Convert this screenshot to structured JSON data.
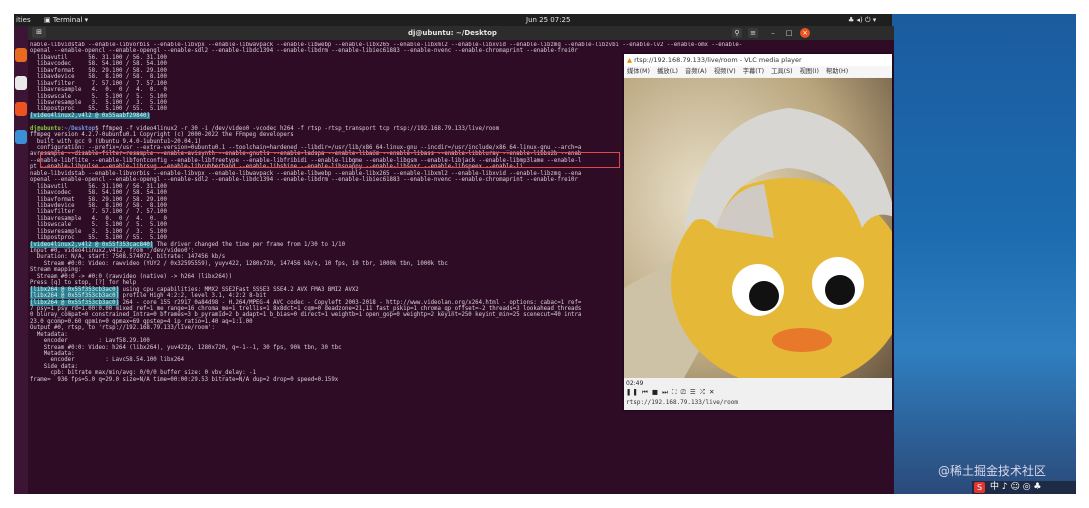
{
  "topbar": {
    "activities": "ities",
    "terminal_menu": "Terminal",
    "clock": "Jun 25 07:25"
  },
  "terminal": {
    "title": "dj@ubuntu: ~/Desktop",
    "lines": [
      {
        "t": "nable-libvidstab --enable-libvorbis --enable-libvpx --enable-libwavpack --enable-libwebp --enable-libx265 --enable-libxml2 --enable-libxvid --enable-libzmq --enable-libzvbi --enable-lv2 --enable-omx --enable-"
      },
      {
        "t": "openal --enable-opencl --enable-opengl --enable-sdl2 --enable-libdc1394 --enable-libdrm --enable-libiec61883 --enable-nvenc --enable-chromaprint --enable-frei0r"
      },
      {
        "t": "  libavutil      56. 31.100 / 56. 31.100"
      },
      {
        "t": "  libavcodec     58. 54.100 / 58. 54.100"
      },
      {
        "t": "  libavformat    58. 29.100 / 58. 29.100"
      },
      {
        "t": "  libavdevice    58.  8.100 / 58.  8.100"
      },
      {
        "t": "  libavfilter     7. 57.100 /  7. 57.100"
      },
      {
        "t": "  libavresample   4.  0.  0 /  4.  0.  0"
      },
      {
        "t": "  libswscale      5.  5.100 /  5.  5.100"
      },
      {
        "t": "  libswresample   3.  5.100 /  3.  5.100"
      },
      {
        "t": "  libpostproc    55.  5.100 / 55.  5.100"
      },
      {
        "t": "[video4linux2,v4l2 @ 0x55aabf29840]",
        "cls": "hl-cyan"
      },
      {
        "t": ""
      },
      {
        "t": "",
        "prompt": true,
        "user": "dj@ubuntu",
        "path": "~/Desktop",
        "cmd": "$ ffmpeg -f video4linux2 -r 30 -i /dev/video0 -vcodec h264 -f rtsp -rtsp_transport tcp rtsp://192.168.79.133/live/room"
      },
      {
        "t": "ffmpeg version 4.2.7-0ubuntu0.1 Copyright (c) 2000-2022 the FFmpeg developers"
      },
      {
        "t": "  built with gcc 9 (Ubuntu 9.4.0-1ubuntu1~20.04.1)"
      },
      {
        "t": "  configuration: --prefix=/usr --extra-version=0ubuntu0.1 --toolchain=hardened --libdir=/usr/lib/x86_64-linux-gnu --incdir=/usr/include/x86_64-linux-gnu --arch=a"
      },
      {
        "t": "avresample --disable-filter=resample --enable-avisynth --enable-gnutls --enable-ladspa --enable-libaom --enable-libass --enable-libbluray --enable-libbs2b --enab"
      },
      {
        "t": "--enable-libflite --enable-libfontconfig --enable-libfreetype --enable-libfribidi --enable-libgme --enable-libgsm --enable-libjack --enable-libmp3lame --enable-l"
      },
      {
        "t": "pt --enable-libpulse --enable-librsvg --enable-librubberband --enable-libshine --enable-libsnappy --enable-libsoxr --enable-libspeex --enable-li"
      },
      {
        "t": "nable-libvidstab --enable-libvorbis --enable-libvpx --enable-libwavpack --enable-libwebp --enable-libx265 --enable-libxml2 --enable-libxvid --enable-libzmq --ena"
      },
      {
        "t": "openal --enable-opencl --enable-opengl --enable-sdl2 --enable-libdc1394 --enable-libdrm --enable-libiec61883 --enable-nvenc --enable-chromaprint --enable-frei0r"
      },
      {
        "t": "  libavutil      56. 31.100 / 56. 31.100"
      },
      {
        "t": "  libavcodec     58. 54.100 / 58. 54.100"
      },
      {
        "t": "  libavformat    58. 29.100 / 58. 29.100"
      },
      {
        "t": "  libavdevice    58.  8.100 / 58.  8.100"
      },
      {
        "t": "  libavfilter     7. 57.100 /  7. 57.100"
      },
      {
        "t": "  libavresample   4.  0.  0 /  4.  0.  0"
      },
      {
        "t": "  libswscale      5.  5.100 /  5.  5.100"
      },
      {
        "t": "  libswresample   3.  5.100 /  3.  5.100"
      },
      {
        "t": "  libpostproc    55.  5.100 / 55.  5.100"
      },
      {
        "t": " The driver changed the time per frame from 1/30 to 1/10",
        "tag": "[video4linux2,v4l2 @ 0x55f353cac840]"
      },
      {
        "t": "Input #0, video4linux2,v4l2, from '/dev/video0':"
      },
      {
        "t": "  Duration: N/A, start: 7508.574072, bitrate: 147456 kb/s"
      },
      {
        "t": "    Stream #0:0: Video: rawvideo (YUY2 / 0x32595559), yuyv422, 1280x720, 147456 kb/s, 10 fps, 10 tbr, 1000k tbn, 1000k tbc"
      },
      {
        "t": "Stream mapping:"
      },
      {
        "t": "  Stream #0:0 -> #0:0 (rawvideo (native) -> h264 (libx264))"
      },
      {
        "t": "Press [q] to stop, [?] for help"
      },
      {
        "t": " using cpu capabilities: MMX2 SSE2Fast SSSE3 SSE4.2 AVX FMA3 BMI2 AVX2",
        "tag": "[libx264 @ 0x55f353cb3ac0]"
      },
      {
        "t": " profile High 4:2:2, level 3.1, 4:2:2 8-bit",
        "tag": "[libx264 @ 0x55f353cb3ac0]"
      },
      {
        "t": " 264 - core 155 r2917 0a84d98 - H.264/MPEG-4 AVC codec - Copyleft 2003-2018 - http://www.videolan.org/x264.html - options: cabac=1 ref=",
        "tag": "[libx264 @ 0x55f353cb3ac0]"
      },
      {
        "t": "7 psy=1 psy_rd=1.00:0.00 mixed_ref=1 me_range=16 chroma_me=1 trellis=1 8x8dct=1 cqm=0 deadzone=21,11 fast_pskip=1 chroma_qp_offset=-2 threads=3 lookahead_threads"
      },
      {
        "t": "0 bluray_compat=0 constrained_intra=0 bframes=3 b_pyramid=2 b_adapt=1 b_bias=0 direct=1 weightb=1 open_gop=0 weightp=2 keyint=250 keyint_min=25 scenecut=40 intra"
      },
      {
        "t": "23.0 qcomp=0.60 qpmin=0 qpmax=69 qpstep=4 ip_ratio=1.40 aq=1:1.00"
      },
      {
        "t": "Output #0, rtsp, to 'rtsp://192.168.79.133/live/room':"
      },
      {
        "t": "  Metadata:"
      },
      {
        "t": "    encoder         : Lavf58.29.100"
      },
      {
        "t": "    Stream #0:0: Video: h264 (libx264), yuv422p, 1280x720, q=-1--1, 30 fps, 90k tbn, 30 tbc"
      },
      {
        "t": "    Metadata:"
      },
      {
        "t": "      encoder         : Lavc58.54.100 libx264"
      },
      {
        "t": "    Side data:"
      },
      {
        "t": "      cpb: bitrate max/min/avg: 0/0/0 buffer size: 0 vbv_delay: -1"
      },
      {
        "t": "frame=  936 fps=5.0 q=29.0 size=N/A time=00:00:29.53 bitrate=N/A dup=2 drop=0 speed=0.159x"
      }
    ]
  },
  "vlc": {
    "title": "rtsp://192.168.79.133/live/room - VLC media player",
    "menu": [
      "媒体(M)",
      "播放(L)",
      "音频(A)",
      "视频(V)",
      "字幕(T)",
      "工具(S)",
      "视图(I)",
      "帮助(H)"
    ],
    "time": "02:49",
    "url": "rtsp://192.168.79.133/live/room"
  },
  "watermark": "@稀土掘金技术社区",
  "tray": {
    "label": "中 ♪ ☺ ◎ ♣",
    "logo": "S"
  }
}
